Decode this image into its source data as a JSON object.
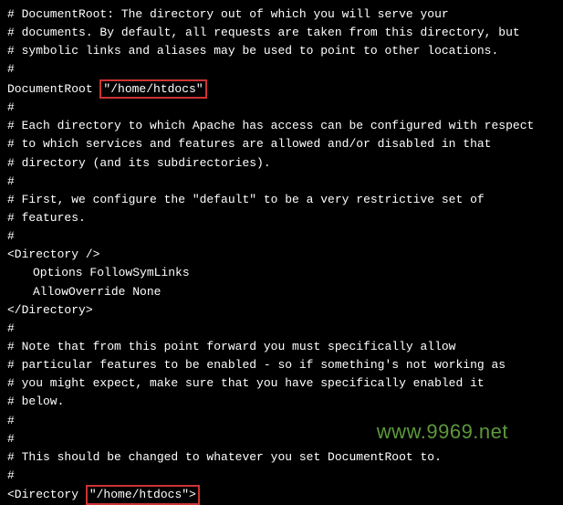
{
  "lines": {
    "l1": "# DocumentRoot: The directory out of which you will serve your",
    "l2": "# documents. By default, all requests are taken from this directory, but",
    "l3": "# symbolic links and aliases may be used to point to other locations.",
    "l4": "#",
    "l5a": "DocumentRoot ",
    "l5b": "\"/home/htdocs\"",
    "l6": "",
    "l7": "#",
    "l8": "# Each directory to which Apache has access can be configured with respect",
    "l9": "# to which services and features are allowed and/or disabled in that",
    "l10": "# directory (and its subdirectories).",
    "l11": "#",
    "l12": "# First, we configure the \"default\" to be a very restrictive set of",
    "l13": "# features.",
    "l14": "#",
    "l15": "<Directory />",
    "l16": "Options FollowSymLinks",
    "l17": "AllowOverride None",
    "l18": "</Directory>",
    "l19": "",
    "l20": "#",
    "l21": "# Note that from this point forward you must specifically allow",
    "l22": "# particular features to be enabled - so if something's not working as",
    "l23": "# you might expect, make sure that you have specifically enabled it",
    "l24": "# below.",
    "l25": "#",
    "l26": "",
    "l27": "#",
    "l28": "# This should be changed to whatever you set DocumentRoot to.",
    "l29": "#",
    "l30a": "<Directory ",
    "l30b": "\"/home/htdocs\">"
  },
  "watermark": "www.9969.net"
}
